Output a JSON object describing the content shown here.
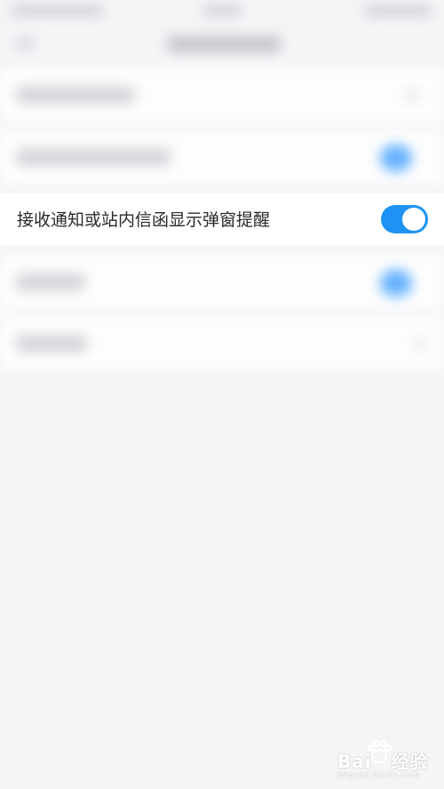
{
  "settings": {
    "popup_row": {
      "label": "接收通知或站内信函显示弹窗提醒",
      "toggle_on": true
    }
  },
  "colors": {
    "accent": "#1e93f5",
    "background": "#f4f5f7",
    "row_background": "#ffffff"
  },
  "watermark": {
    "brand": "Bai",
    "brand_suffix": "经验",
    "url": "jingyan.baidu.com"
  }
}
